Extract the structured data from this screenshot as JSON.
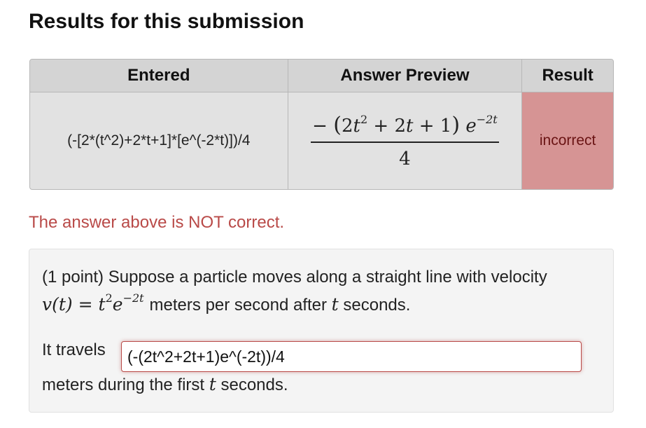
{
  "heading": "Results for this submission",
  "results_table": {
    "headers": {
      "entered": "Entered",
      "preview": "Answer Preview",
      "result": "Result"
    },
    "row": {
      "entered": "(-[2*(t^2)+2*t+1]*[e^(-2*t)])/4",
      "preview": {
        "minus": "−",
        "open_paren": "(",
        "term1_coef": "2",
        "term1_var": "t",
        "term1_exp": "2",
        "plus1": "+",
        "term2": "2",
        "term2_var": "t",
        "plus2": "+",
        "term3": "1",
        "close_paren": ")",
        "exp_base": "e",
        "exp_power": "−2t",
        "denominator": "4"
      },
      "result": "incorrect"
    },
    "result_color": "#d69494"
  },
  "status_message": "The answer above is NOT correct.",
  "problem": {
    "line1": "(1 point) Suppose a particle moves along a straight line with velocity",
    "velocity_lhs": "v(t)",
    "equals": "=",
    "velocity_base": "t",
    "velocity_base_exp": "2",
    "velocity_e": "e",
    "velocity_e_exp": "−2t",
    "line2_mid": "meters per second after",
    "var_t": "t",
    "line2_end": "seconds.",
    "answer_prefix": "It travels",
    "answer_value": "(-(2t^2+2t+1)e^(-2t))/4",
    "after_prefix": "meters during the first",
    "after_var": "t",
    "after_end": "seconds."
  }
}
